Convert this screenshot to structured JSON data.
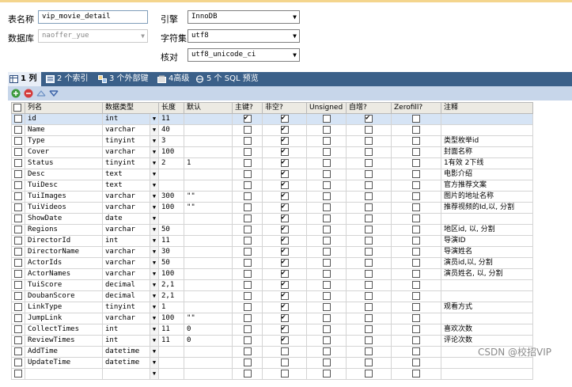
{
  "form": {
    "table_name_label": "表名称",
    "table_name_value": "vip_movie_detail",
    "database_label": "数据库",
    "database_value": "naoffer_yue",
    "engine_label": "引擎",
    "engine_value": "InnoDB",
    "charset_label": "字符集",
    "charset_value": "utf8",
    "collation_label": "核对",
    "collation_value": "utf8_unicode_ci"
  },
  "tabs": [
    {
      "label": "1 列"
    },
    {
      "label": "2 个索引"
    },
    {
      "label": "3 个外部键"
    },
    {
      "label": "4高级"
    },
    {
      "label": "5 个 SQL 预览"
    }
  ],
  "columns_header": [
    "列名",
    "数据类型",
    "长度",
    "默认",
    "主键?",
    "非空?",
    "Unsigned",
    "自增?",
    "Zerofill?",
    "注释"
  ],
  "rows": [
    {
      "name": "id",
      "type": "int",
      "len": "11",
      "def": "",
      "pk": true,
      "nn": true,
      "ai": true,
      "comment": ""
    },
    {
      "name": "Name",
      "type": "varchar",
      "len": "40",
      "def": "",
      "pk": false,
      "nn": true,
      "ai": false,
      "comment": ""
    },
    {
      "name": "Type",
      "type": "tinyint",
      "len": "3",
      "def": "",
      "pk": false,
      "nn": true,
      "ai": false,
      "comment": "类型枚举id"
    },
    {
      "name": "Cover",
      "type": "varchar",
      "len": "100",
      "def": "",
      "pk": false,
      "nn": true,
      "ai": false,
      "comment": "封面名称"
    },
    {
      "name": "Status",
      "type": "tinyint",
      "len": "2",
      "def": "1",
      "pk": false,
      "nn": true,
      "ai": false,
      "comment": "1有效 2下线"
    },
    {
      "name": "Desc",
      "type": "text",
      "len": "",
      "def": "",
      "pk": false,
      "nn": true,
      "ai": false,
      "comment": "电影介绍"
    },
    {
      "name": "TuiDesc",
      "type": "text",
      "len": "",
      "def": "",
      "pk": false,
      "nn": true,
      "ai": false,
      "comment": "官方推荐文案"
    },
    {
      "name": "TuiImages",
      "type": "varchar",
      "len": "300",
      "def": "\"\"",
      "pk": false,
      "nn": true,
      "ai": false,
      "comment": "图片的地址名称"
    },
    {
      "name": "TuiVideos",
      "type": "varchar",
      "len": "100",
      "def": "\"\"",
      "pk": false,
      "nn": true,
      "ai": false,
      "comment": "推荐视频的Id,以, 分割"
    },
    {
      "name": "ShowDate",
      "type": "date",
      "len": "",
      "def": "",
      "pk": false,
      "nn": true,
      "ai": false,
      "comment": ""
    },
    {
      "name": "Regions",
      "type": "varchar",
      "len": "50",
      "def": "",
      "pk": false,
      "nn": true,
      "ai": false,
      "comment": "地区id, 以, 分割"
    },
    {
      "name": "DirectorId",
      "type": "int",
      "len": "11",
      "def": "",
      "pk": false,
      "nn": true,
      "ai": false,
      "comment": "导演ID"
    },
    {
      "name": "DirectorName",
      "type": "varchar",
      "len": "30",
      "def": "",
      "pk": false,
      "nn": true,
      "ai": false,
      "comment": "导演姓名"
    },
    {
      "name": "ActorIds",
      "type": "varchar",
      "len": "50",
      "def": "",
      "pk": false,
      "nn": true,
      "ai": false,
      "comment": "演员id,以, 分割"
    },
    {
      "name": "ActorNames",
      "type": "varchar",
      "len": "100",
      "def": "",
      "pk": false,
      "nn": true,
      "ai": false,
      "comment": "演员姓名, 以, 分割"
    },
    {
      "name": "TuiScore",
      "type": "decimal",
      "len": "2,1",
      "def": "",
      "pk": false,
      "nn": true,
      "ai": false,
      "comment": ""
    },
    {
      "name": "DoubanScore",
      "type": "decimal",
      "len": "2,1",
      "def": "",
      "pk": false,
      "nn": true,
      "ai": false,
      "comment": ""
    },
    {
      "name": "LinkType",
      "type": "tinyint",
      "len": "1",
      "def": "",
      "pk": false,
      "nn": true,
      "ai": false,
      "comment": "观看方式"
    },
    {
      "name": "JumpLink",
      "type": "varchar",
      "len": "100",
      "def": "\"\"",
      "pk": false,
      "nn": true,
      "ai": false,
      "comment": ""
    },
    {
      "name": "CollectTimes",
      "type": "int",
      "len": "11",
      "def": "0",
      "pk": false,
      "nn": true,
      "ai": false,
      "comment": "喜欢次数"
    },
    {
      "name": "ReviewTimes",
      "type": "int",
      "len": "11",
      "def": "0",
      "pk": false,
      "nn": true,
      "ai": false,
      "comment": "评论次数"
    },
    {
      "name": "AddTime",
      "type": "datetime",
      "len": "",
      "def": "",
      "pk": false,
      "nn": false,
      "ai": false,
      "comment": ""
    },
    {
      "name": "UpdateTime",
      "type": "datetime",
      "len": "",
      "def": "",
      "pk": false,
      "nn": false,
      "ai": false,
      "comment": ""
    },
    {
      "name": "",
      "type": "",
      "len": "",
      "def": "",
      "pk": false,
      "nn": false,
      "ai": false,
      "comment": ""
    }
  ],
  "watermark": "CSDN @校招VIP",
  "colors": {
    "tab_bar": "#3b6089",
    "toolbar": "#c7d6ea",
    "selected_row": "#d6e4f5"
  }
}
